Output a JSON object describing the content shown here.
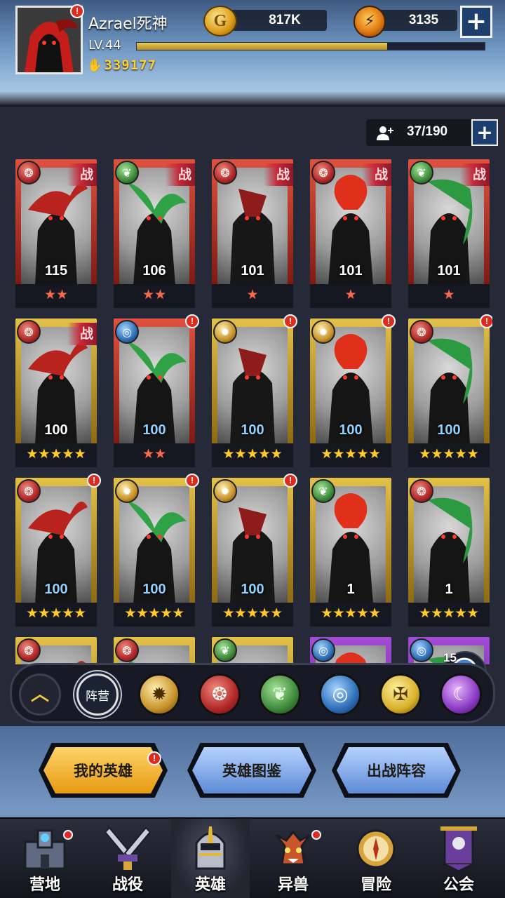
{
  "player": {
    "name": "Azrael死神",
    "level": "LV.44",
    "power": "339177",
    "xp_progress": 0.72
  },
  "resources": {
    "gold": "817K",
    "energy": "3135"
  },
  "capacity": "37/190",
  "heroes": [
    {
      "level": "115",
      "stars": 2,
      "star_color": "red",
      "faction": "red",
      "frame": "red",
      "battle": true,
      "alert": false,
      "level_color": "white"
    },
    {
      "level": "106",
      "stars": 2,
      "star_color": "red",
      "faction": "green",
      "frame": "red",
      "battle": true,
      "alert": false,
      "level_color": "white"
    },
    {
      "level": "101",
      "stars": 1,
      "star_color": "red",
      "faction": "red",
      "frame": "red",
      "battle": true,
      "alert": false,
      "level_color": "white"
    },
    {
      "level": "101",
      "stars": 1,
      "star_color": "red",
      "faction": "red",
      "frame": "red",
      "battle": true,
      "alert": false,
      "level_color": "white"
    },
    {
      "level": "101",
      "stars": 1,
      "star_color": "red",
      "faction": "green",
      "frame": "red",
      "battle": true,
      "alert": false,
      "level_color": "white"
    },
    {
      "level": "100",
      "stars": 5,
      "star_color": "gold",
      "faction": "red",
      "frame": "gold",
      "battle": true,
      "alert": false,
      "level_color": "white"
    },
    {
      "level": "100",
      "stars": 2,
      "star_color": "red",
      "faction": "blue",
      "frame": "red",
      "battle": false,
      "alert": true,
      "level_color": "blue"
    },
    {
      "level": "100",
      "stars": 5,
      "star_color": "gold",
      "faction": "sun",
      "frame": "gold",
      "battle": false,
      "alert": true,
      "level_color": "blue"
    },
    {
      "level": "100",
      "stars": 5,
      "star_color": "gold",
      "faction": "sun",
      "frame": "gold",
      "battle": false,
      "alert": true,
      "level_color": "blue"
    },
    {
      "level": "100",
      "stars": 5,
      "star_color": "gold",
      "faction": "red",
      "frame": "gold",
      "battle": false,
      "alert": true,
      "level_color": "blue"
    },
    {
      "level": "100",
      "stars": 5,
      "star_color": "gold",
      "faction": "red",
      "frame": "gold",
      "battle": false,
      "alert": true,
      "level_color": "blue"
    },
    {
      "level": "100",
      "stars": 5,
      "star_color": "gold",
      "faction": "sun",
      "frame": "gold",
      "battle": false,
      "alert": true,
      "level_color": "blue"
    },
    {
      "level": "100",
      "stars": 5,
      "star_color": "gold",
      "faction": "sun",
      "frame": "gold",
      "battle": false,
      "alert": true,
      "level_color": "blue"
    },
    {
      "level": "1",
      "stars": 5,
      "star_color": "gold",
      "faction": "green",
      "frame": "gold",
      "battle": false,
      "alert": false,
      "level_color": "white"
    },
    {
      "level": "1",
      "stars": 5,
      "star_color": "gold",
      "faction": "red",
      "frame": "gold",
      "battle": false,
      "alert": false,
      "level_color": "white"
    },
    {
      "level": "",
      "stars": 0,
      "star_color": "gold",
      "faction": "red",
      "frame": "gold",
      "battle": false,
      "alert": false,
      "level_color": "white"
    },
    {
      "level": "",
      "stars": 0,
      "star_color": "gold",
      "faction": "red",
      "frame": "gold",
      "battle": false,
      "alert": false,
      "level_color": "white"
    },
    {
      "level": "",
      "stars": 0,
      "star_color": "gold",
      "faction": "green",
      "frame": "gold",
      "battle": false,
      "alert": false,
      "level_color": "white"
    },
    {
      "level": "",
      "stars": 0,
      "star_color": "gold",
      "faction": "blue",
      "frame": "purple",
      "battle": false,
      "alert": false,
      "level_color": "white"
    },
    {
      "level": "",
      "stars": 0,
      "star_color": "gold",
      "faction": "blue",
      "frame": "purple",
      "battle": false,
      "alert": false,
      "level_color": "white"
    }
  ],
  "battle_tag": "战",
  "alert_mark": "!",
  "chat_count": "15",
  "filters": {
    "camp_label": "阵营",
    "factions": [
      "sun",
      "red",
      "green",
      "blue",
      "holy",
      "purple"
    ]
  },
  "tabs": {
    "my_heroes": "我的英雄",
    "hero_codex": "英雄图鉴",
    "lineup": "出战阵容"
  },
  "nav": [
    {
      "label": "营地",
      "icon": "camp-icon",
      "dot": true
    },
    {
      "label": "战役",
      "icon": "crossed-swords-icon",
      "dot": false
    },
    {
      "label": "英雄",
      "icon": "helmet-icon",
      "dot": false,
      "active": true
    },
    {
      "label": "异兽",
      "icon": "beast-icon",
      "dot": true
    },
    {
      "label": "冒险",
      "icon": "compass-icon",
      "dot": false
    },
    {
      "label": "公会",
      "icon": "guild-banner-icon",
      "dot": false
    }
  ],
  "colors": {
    "accent_gold": "#ffcf3a",
    "alert_red": "#e02a1f",
    "level_blue": "#8fd0ff"
  }
}
